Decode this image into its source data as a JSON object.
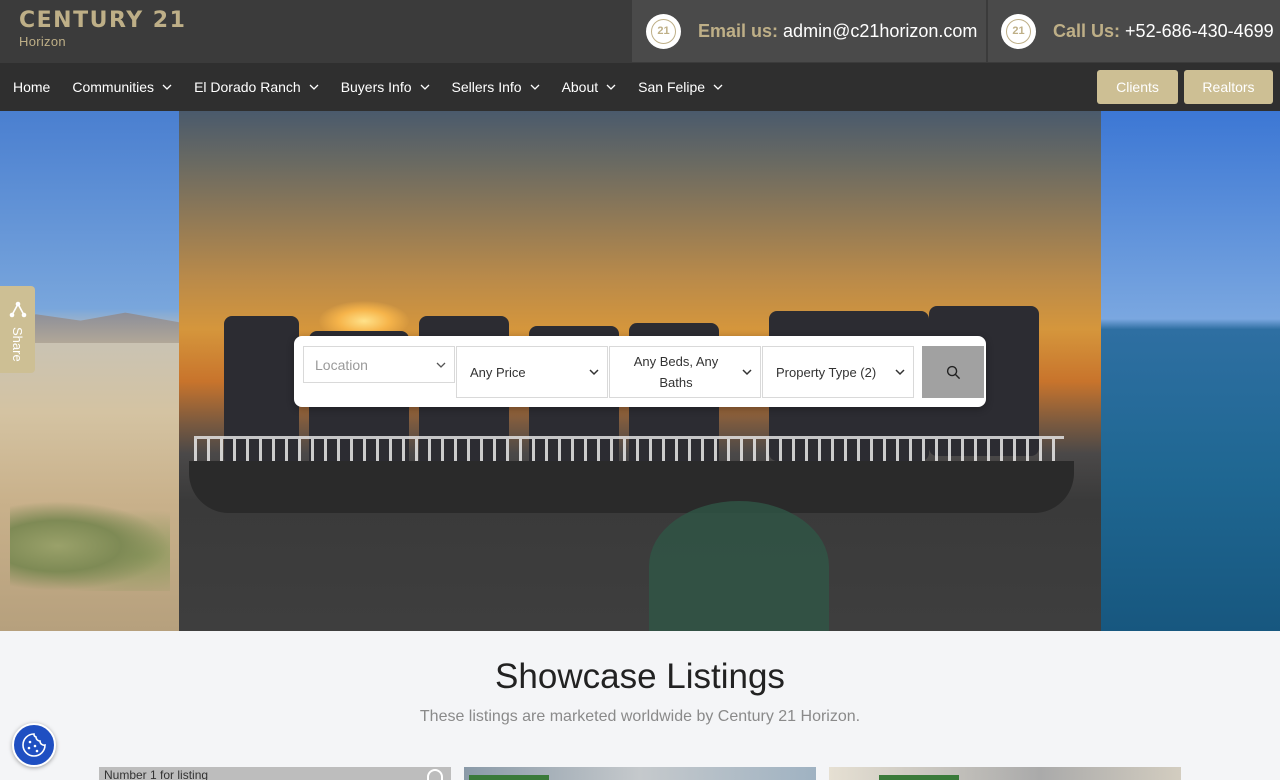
{
  "brand": {
    "name": "CENTURY 21",
    "sub": "Horizon"
  },
  "contact": {
    "email_label": "Email us:",
    "email": "admin@c21horizon.com",
    "phone_label": "Call Us:",
    "phone": "+52-686-430-4699",
    "badge_text": "21"
  },
  "nav": {
    "items": [
      "Home",
      "Communities",
      "El Dorado Ranch",
      "Buyers Info",
      "Sellers Info",
      "About",
      "San Felipe"
    ],
    "clients_label": "Clients",
    "realtors_label": "Realtors"
  },
  "search": {
    "location_placeholder": "Location",
    "price": "Any Price",
    "beds_line1": "Any Beds, Any",
    "beds_line2": "Baths",
    "property_type": "Property Type (2)"
  },
  "share": {
    "label": "Share"
  },
  "showcase": {
    "title": "Showcase Listings",
    "subtitle": "These listings are marketed worldwide by Century 21 Horizon.",
    "card1_label": "Number 1 for listing"
  },
  "colors": {
    "gold": "#cdbf94",
    "topbar": "#3b3b3b",
    "nav": "#2f2f2f",
    "cookie": "#1f4fc2"
  },
  "icons": [
    "c21-badge-icon",
    "chevron-down-icon",
    "search-icon",
    "share-icon",
    "heart-icon",
    "cookie-icon"
  ]
}
